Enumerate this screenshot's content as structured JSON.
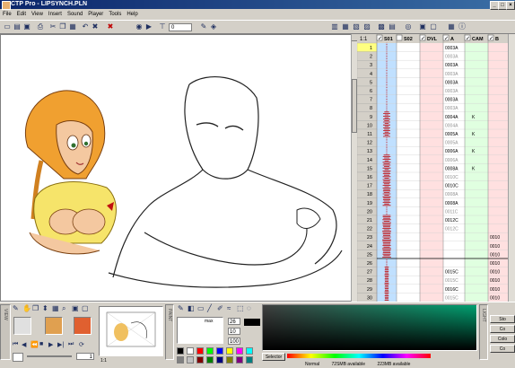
{
  "window": {
    "title": "CTP Pro - LIPSYNCH.PLN"
  },
  "menu": [
    "File",
    "Edit",
    "View",
    "Insert",
    "Sound",
    "Player",
    "Tools",
    "Help"
  ],
  "toolbar": {
    "frame_select": "0"
  },
  "sheet": {
    "zoom": "1:1",
    "columns": [
      {
        "label": "S01",
        "checked": true,
        "color": "#c0e0ff"
      },
      {
        "label": "S02",
        "checked": false,
        "color": "#ffffff"
      },
      {
        "label": "DVL",
        "checked": true,
        "color": "#ffe0e0"
      },
      {
        "label": "A",
        "checked": true,
        "color": "#ffffff"
      },
      {
        "label": "CAM",
        "checked": true,
        "color": "#e0ffe0"
      },
      {
        "label": "B",
        "checked": true,
        "color": "#ffe0e0"
      }
    ],
    "rows": [
      {
        "n": "1",
        "a": "0003A",
        "cam": "",
        "b": ""
      },
      {
        "n": "2",
        "a": "0003A",
        "cam": "",
        "b": ""
      },
      {
        "n": "3",
        "a": "0003A",
        "cam": "",
        "b": ""
      },
      {
        "n": "4",
        "a": "0003A",
        "cam": "",
        "b": ""
      },
      {
        "n": "5",
        "a": "0003A",
        "cam": "",
        "b": ""
      },
      {
        "n": "6",
        "a": "0003A",
        "cam": "",
        "b": ""
      },
      {
        "n": "7",
        "a": "0003A",
        "cam": "",
        "b": ""
      },
      {
        "n": "8",
        "a": "0003A",
        "cam": "",
        "b": ""
      },
      {
        "n": "9",
        "a": "0004A",
        "cam": "K",
        "b": ""
      },
      {
        "n": "10",
        "a": "0004A",
        "cam": "",
        "b": ""
      },
      {
        "n": "11",
        "a": "0005A",
        "cam": "K",
        "b": ""
      },
      {
        "n": "12",
        "a": "0005A",
        "cam": "",
        "b": ""
      },
      {
        "n": "13",
        "a": "0006A",
        "cam": "K",
        "b": ""
      },
      {
        "n": "14",
        "a": "0006A",
        "cam": "",
        "b": ""
      },
      {
        "n": "15",
        "a": "0008A",
        "cam": "K",
        "b": ""
      },
      {
        "n": "16",
        "a": "0010C",
        "cam": "",
        "b": ""
      },
      {
        "n": "17",
        "a": "0010C",
        "cam": "",
        "b": ""
      },
      {
        "n": "18",
        "a": "0008A",
        "cam": "",
        "b": ""
      },
      {
        "n": "19",
        "a": "0008A",
        "cam": "",
        "b": ""
      },
      {
        "n": "20",
        "a": "0011C",
        "cam": "",
        "b": ""
      },
      {
        "n": "21",
        "a": "0012C",
        "cam": "",
        "b": ""
      },
      {
        "n": "22",
        "a": "0012C",
        "cam": "",
        "b": ""
      },
      {
        "n": "23",
        "a": "",
        "cam": "",
        "b": "0010"
      },
      {
        "n": "24",
        "a": "",
        "cam": "",
        "b": "0010"
      },
      {
        "n": "25",
        "a": "",
        "cam": "",
        "b": "0010"
      },
      {
        "n": "26",
        "a": "",
        "cam": "",
        "b": "0010"
      },
      {
        "n": "27",
        "a": "0015C",
        "cam": "",
        "b": "0010"
      },
      {
        "n": "28",
        "a": "0015C",
        "cam": "",
        "b": "0010"
      },
      {
        "n": "29",
        "a": "0016C",
        "cam": "",
        "b": "0010"
      },
      {
        "n": "30",
        "a": "0015C",
        "cam": "",
        "b": "0010"
      }
    ]
  },
  "bottom": {
    "view_label": "VIEW",
    "paint_label": "PAINT",
    "light_label": "LIGHT",
    "frame_value": "1",
    "ratio": "1:1",
    "max_label": "max",
    "value1": "26",
    "value2": "10",
    "value3": "100",
    "selector_label": "Selector",
    "right_buttons": [
      "Sto",
      "Co",
      "Colo",
      "Co"
    ],
    "status": {
      "mode": "Normal",
      "mem1": "72SMB available",
      "mem2": "223MB available"
    }
  },
  "colors": {
    "accent": "#0a246a",
    "waveform": "#c00000",
    "palette": [
      "#000000",
      "#ffffff",
      "#ff0000",
      "#00ff00",
      "#0000ff",
      "#ffff00",
      "#ff00ff",
      "#00ffff",
      "#808080",
      "#c0c0c0",
      "#800000",
      "#008000",
      "#000080",
      "#808000",
      "#800080",
      "#008080"
    ]
  }
}
